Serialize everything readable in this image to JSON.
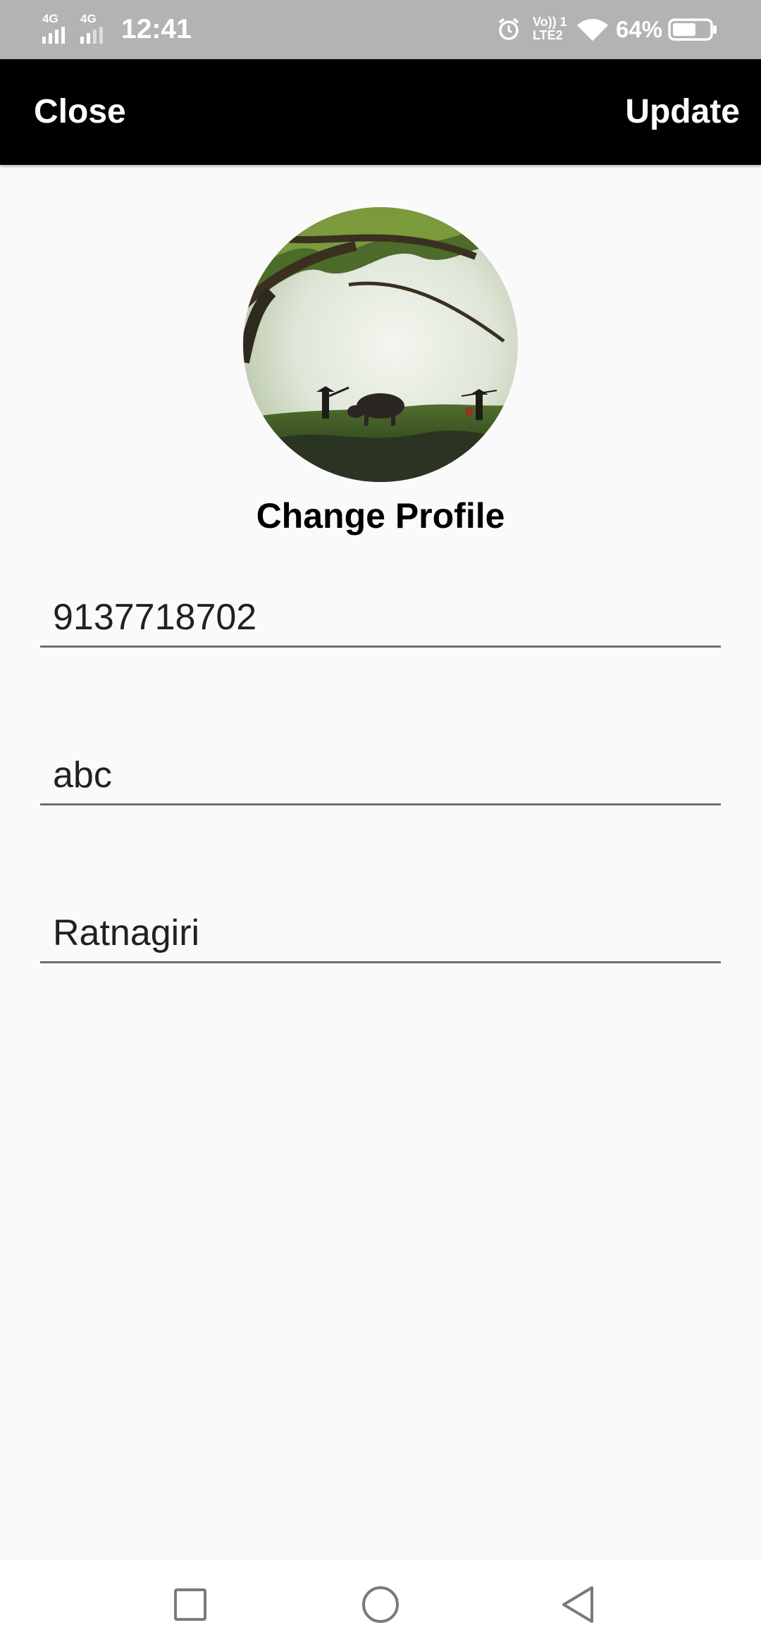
{
  "status_bar": {
    "network_left_1": "4G",
    "network_left_2": "4G",
    "time": "12:41",
    "volte_top": "Vo)) 1",
    "volte_bottom": "LTE2",
    "battery_percent": "64%",
    "battery_level": 0.64,
    "icons": [
      "signal-icon",
      "signal-icon",
      "alarm-icon",
      "volte-icon",
      "wifi-icon",
      "battery-icon"
    ]
  },
  "toolbar": {
    "close_label": "Close",
    "update_label": "Update",
    "background": "#000000"
  },
  "profile": {
    "change_label": "Change Profile"
  },
  "form": {
    "fields": [
      {
        "value": "9137718702"
      },
      {
        "value": "abc"
      },
      {
        "value": "Ratnagiri"
      }
    ]
  },
  "nav_bar": {
    "icons": [
      "recent-apps-icon",
      "home-icon",
      "back-icon"
    ]
  }
}
